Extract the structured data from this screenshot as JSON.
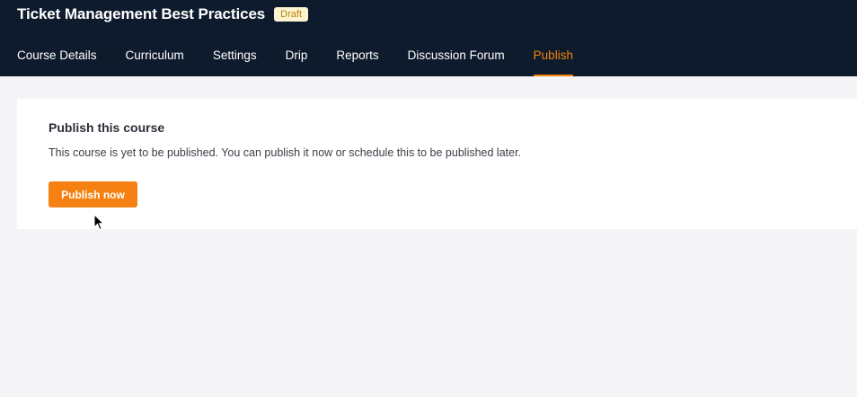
{
  "header": {
    "course_title": "Ticket Management Best Practices",
    "status_badge": "Draft"
  },
  "tabs": [
    {
      "label": "Course Details",
      "active": false
    },
    {
      "label": "Curriculum",
      "active": false
    },
    {
      "label": "Settings",
      "active": false
    },
    {
      "label": "Drip",
      "active": false
    },
    {
      "label": "Reports",
      "active": false
    },
    {
      "label": "Discussion Forum",
      "active": false
    },
    {
      "label": "Publish",
      "active": true
    }
  ],
  "publish_card": {
    "heading": "Publish this course",
    "description": "This course is yet to be published. You can publish it now or schedule this to be published later.",
    "button_label": "Publish now"
  },
  "colors": {
    "header_bg": "#0e1b2c",
    "accent": "#f5820d",
    "page_bg": "#f5f5f8",
    "badge_bg": "#fdf3d1",
    "badge_text": "#b8860b"
  }
}
